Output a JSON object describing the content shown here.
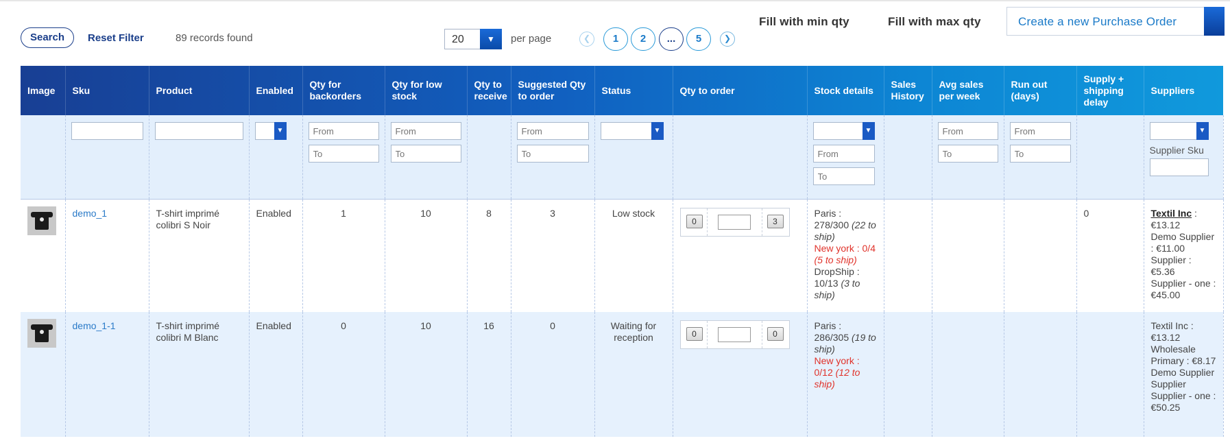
{
  "toolbar": {
    "search_label": "Search",
    "reset_label": "Reset Filter",
    "records_found": "89 records found",
    "per_page_value": "20",
    "per_page_label": "per page",
    "pages": [
      "1",
      "2",
      "...",
      "5"
    ],
    "fill_min_label": "Fill with min qty",
    "fill_max_label": "Fill with max qty",
    "create_po_label": "Create a new Purchase Order"
  },
  "columns": {
    "image": "Image",
    "sku": "Sku",
    "product": "Product",
    "enabled": "Enabled",
    "qty_backorders": "Qty for backorders",
    "qty_low_stock": "Qty for low stock",
    "qty_receive": "Qty to receive",
    "suggested_qty": "Suggested Qty to order",
    "status": "Status",
    "qty_to_order": "Qty to order",
    "stock_details": "Stock details",
    "sales_history": "Sales History",
    "avg_sales": "Avg sales per week",
    "run_out": "Run out (days)",
    "supply_delay": "Supply + shipping delay",
    "suppliers": "Suppliers"
  },
  "filters": {
    "from_placeholder": "From",
    "to_placeholder": "To",
    "supplier_sku_label": "Supplier Sku"
  },
  "rows": [
    {
      "sku": "demo_1",
      "product": "T-shirt imprimé colibri S Noir",
      "enabled": "Enabled",
      "qty_backorders": "1",
      "qty_low_stock": "10",
      "qty_receive": "8",
      "suggested_qty": "3",
      "status": "Low stock",
      "min_btn": "0",
      "max_btn": "3",
      "stock": {
        "paris_label": "Paris :",
        "paris_qty": "278/300",
        "paris_ship": "(22 to ship)",
        "ny_label": "New york : 0/4",
        "ny_ship": "(5 to ship)",
        "drop_label": "DropShip :",
        "drop_qty": "10/13",
        "drop_ship": "(3 to ship)"
      },
      "supply_delay": "0",
      "suppliers": {
        "s1_name": "Textil Inc",
        "s1_price": ": €13.12",
        "s2": "Demo Supplier : €11.00",
        "s3": "Supplier : €5.36",
        "s4": "Supplier - one : €45.00"
      }
    },
    {
      "sku": "demo_1-1",
      "product": "T-shirt imprimé colibri M Blanc",
      "enabled": "Enabled",
      "qty_backorders": "0",
      "qty_low_stock": "10",
      "qty_receive": "16",
      "suggested_qty": "0",
      "status": "Waiting for reception",
      "min_btn": "0",
      "max_btn": "0",
      "stock": {
        "paris_label": "Paris :",
        "paris_qty": "286/305",
        "paris_ship": "(19 to ship)",
        "ny_label": "New york : 0/12",
        "ny_ship": "(12 to ship)"
      },
      "suppliers": {
        "s1": "Textil Inc : €13.12",
        "s2": "Wholesale Primary : €8.17",
        "s3": "Demo Supplier",
        "s4": "Supplier Supplier - one : €50.25"
      }
    }
  ]
}
